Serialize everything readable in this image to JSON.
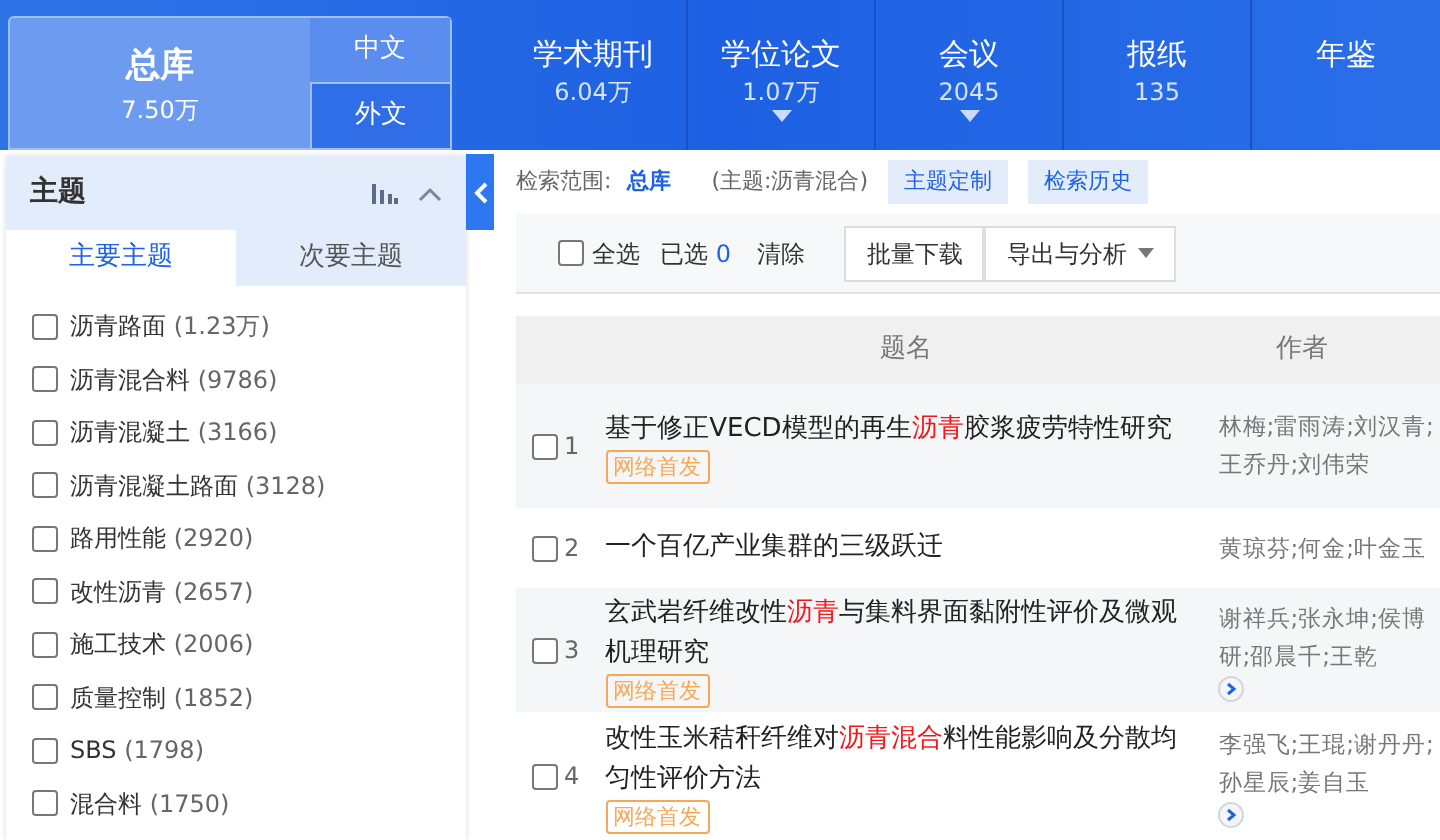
{
  "header": {
    "main_db": {
      "name": "总库",
      "count": "7.50万"
    },
    "lang_tabs": [
      {
        "label": "中文",
        "selected": false
      },
      {
        "label": "外文",
        "selected": false
      }
    ],
    "nav": [
      {
        "label": "学术期刊",
        "count": "6.04万",
        "dropdown": false
      },
      {
        "label": "学位论文",
        "count": "1.07万",
        "dropdown": true
      },
      {
        "label": "会议",
        "count": "2045",
        "dropdown": true
      },
      {
        "label": "报纸",
        "count": "135",
        "dropdown": false
      },
      {
        "label": "年鉴",
        "dropdown": false
      }
    ]
  },
  "sidebar": {
    "title": "主题",
    "tabs": [
      {
        "label": "主要主题",
        "selected": true
      },
      {
        "label": "次要主题",
        "selected": false
      }
    ],
    "items": [
      {
        "label": "沥青路面",
        "count": "(1.23万)",
        "checked": false
      },
      {
        "label": "沥青混合料",
        "count": "(9786)",
        "checked": false
      },
      {
        "label": "沥青混凝土",
        "count": "(3166)",
        "checked": false
      },
      {
        "label": "沥青混凝土路面",
        "count": "(3128)",
        "checked": false
      },
      {
        "label": "路用性能",
        "count": "(2920)",
        "checked": false
      },
      {
        "label": "改性沥青",
        "count": "(2657)",
        "checked": false
      },
      {
        "label": "施工技术",
        "count": "(2006)",
        "checked": false
      },
      {
        "label": "质量控制",
        "count": "(1852)",
        "checked": false
      },
      {
        "label": "SBS",
        "count": "(1798)",
        "checked": false
      },
      {
        "label": "混合料",
        "count": "(1750)",
        "checked": false
      }
    ]
  },
  "scope": {
    "label": "检索范围:",
    "db": "总库",
    "query": "(主题:沥青混合)",
    "buttons": [
      "主题定制",
      "检索历史"
    ]
  },
  "toolbar": {
    "select_all": {
      "label": "全选",
      "checked": false
    },
    "selected_label": "已选",
    "selected_count": "0",
    "clear": "清除",
    "buttons": [
      {
        "label": "批量下载",
        "dropdown": false
      },
      {
        "label": "导出与分析",
        "dropdown": true
      }
    ]
  },
  "table": {
    "columns": [
      "题名",
      "作者"
    ],
    "rows": [
      {
        "index": "1",
        "checked": false,
        "title": [
          {
            "text": "基于修正VECD模型的再生",
            "highlight": false
          },
          {
            "text": "沥青",
            "highlight": true
          },
          {
            "text": "胶浆疲劳特性研究",
            "highlight": false
          }
        ],
        "badge": "网络首发",
        "authors": "林梅;雷雨涛;刘汉青;王乔丹;刘伟荣",
        "more": false
      },
      {
        "index": "2",
        "checked": false,
        "title": [
          {
            "text": "一个百亿产业集群的三级跃迁",
            "highlight": false
          }
        ],
        "authors": "黄琼芬;何金;叶金玉",
        "more": false
      },
      {
        "index": "3",
        "checked": false,
        "title": [
          {
            "text": "玄武岩纤维改性",
            "highlight": false
          },
          {
            "text": "沥青",
            "highlight": true
          },
          {
            "text": "与集料界面黏附性评价及微观机理研究",
            "highlight": false
          }
        ],
        "badge": "网络首发",
        "authors": "谢祥兵;张永坤;侯博研;邵晨千;王乾",
        "more": true
      },
      {
        "index": "4",
        "checked": false,
        "title": [
          {
            "text": "改性玉米秸秆纤维对",
            "highlight": false
          },
          {
            "text": "沥青混合",
            "highlight": true
          },
          {
            "text": "料性能影响及分散均匀性评价方法",
            "highlight": false
          }
        ],
        "badge": "网络首发",
        "authors": "李强飞;王琨;谢丹丹;孙星辰;姜自玉",
        "more": true
      }
    ]
  }
}
